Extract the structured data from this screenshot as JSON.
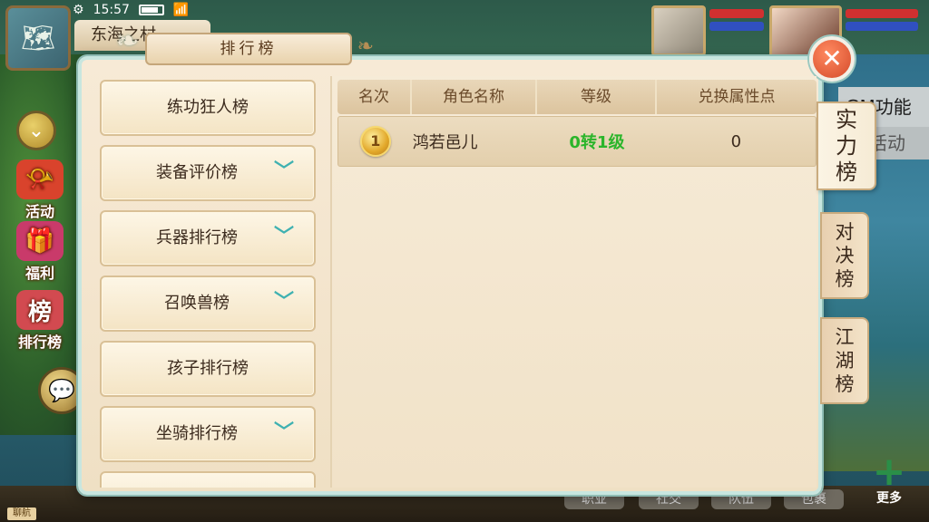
{
  "status_bar": {
    "time": "15:57"
  },
  "location": {
    "name": "东海之村"
  },
  "side_menu": [
    {
      "name": "activity",
      "label": "活动"
    },
    {
      "name": "welfare",
      "label": "福利"
    },
    {
      "name": "ranking",
      "label": "排行榜"
    }
  ],
  "right_hud": {
    "gm_label": "GM功能",
    "activity_label": "活动",
    "more_label": "更多"
  },
  "bottom_bar": [
    "职业",
    "社交",
    "队伍",
    "包裹"
  ],
  "corner_tag": "聊航",
  "panel": {
    "title": "排行榜",
    "categories": [
      {
        "label": "练功狂人榜",
        "expandable": false
      },
      {
        "label": "装备评价榜",
        "expandable": true
      },
      {
        "label": "兵器排行榜",
        "expandable": true
      },
      {
        "label": "召唤兽榜",
        "expandable": true
      },
      {
        "label": "孩子排行榜",
        "expandable": false
      },
      {
        "label": "坐骑排行榜",
        "expandable": true
      },
      {
        "label": "",
        "expandable": false
      }
    ],
    "table": {
      "headers": [
        "名次",
        "角色名称",
        "等级",
        "兑换属性点"
      ],
      "rows": [
        {
          "rank": "1",
          "name": "鸿若邑儿",
          "level": "0转1级",
          "points": "0"
        }
      ]
    },
    "tabs": [
      {
        "label": "实力榜",
        "active": true
      },
      {
        "label": "对决榜",
        "active": false
      },
      {
        "label": "江湖榜",
        "active": false
      }
    ]
  },
  "colors": {
    "level_text": "#2bb52b",
    "panel_border": "#c8e6df",
    "chevron": "#3fb1b1"
  }
}
